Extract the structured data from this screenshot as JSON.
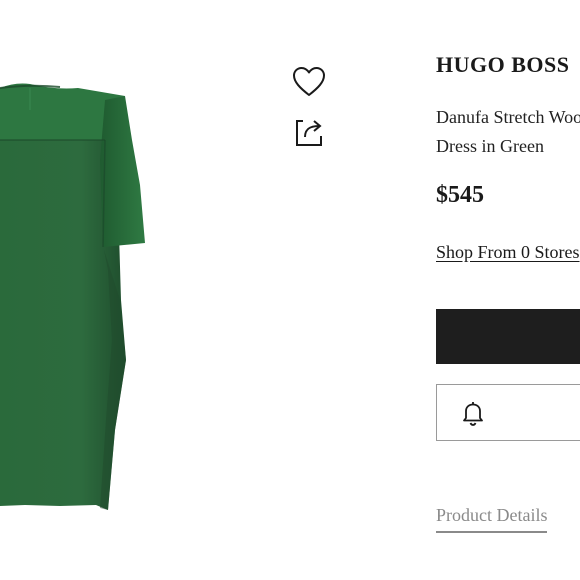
{
  "product": {
    "brand": "HUGO BOSS",
    "name": "Danufa Stretch Wool Dress in Green",
    "price": "$545",
    "shop_link": "Shop From 0 Stores"
  },
  "actions": {
    "wishlist_icon": "heart-icon",
    "share_icon": "share-icon",
    "notify_icon": "bell-icon"
  },
  "tabs": {
    "details": "Product Details"
  },
  "colors": {
    "dress_green": "#2c6b3e",
    "dress_dark": "#244f31",
    "button_dark": "#1e1e1e",
    "muted_text": "#8a8a8a"
  }
}
